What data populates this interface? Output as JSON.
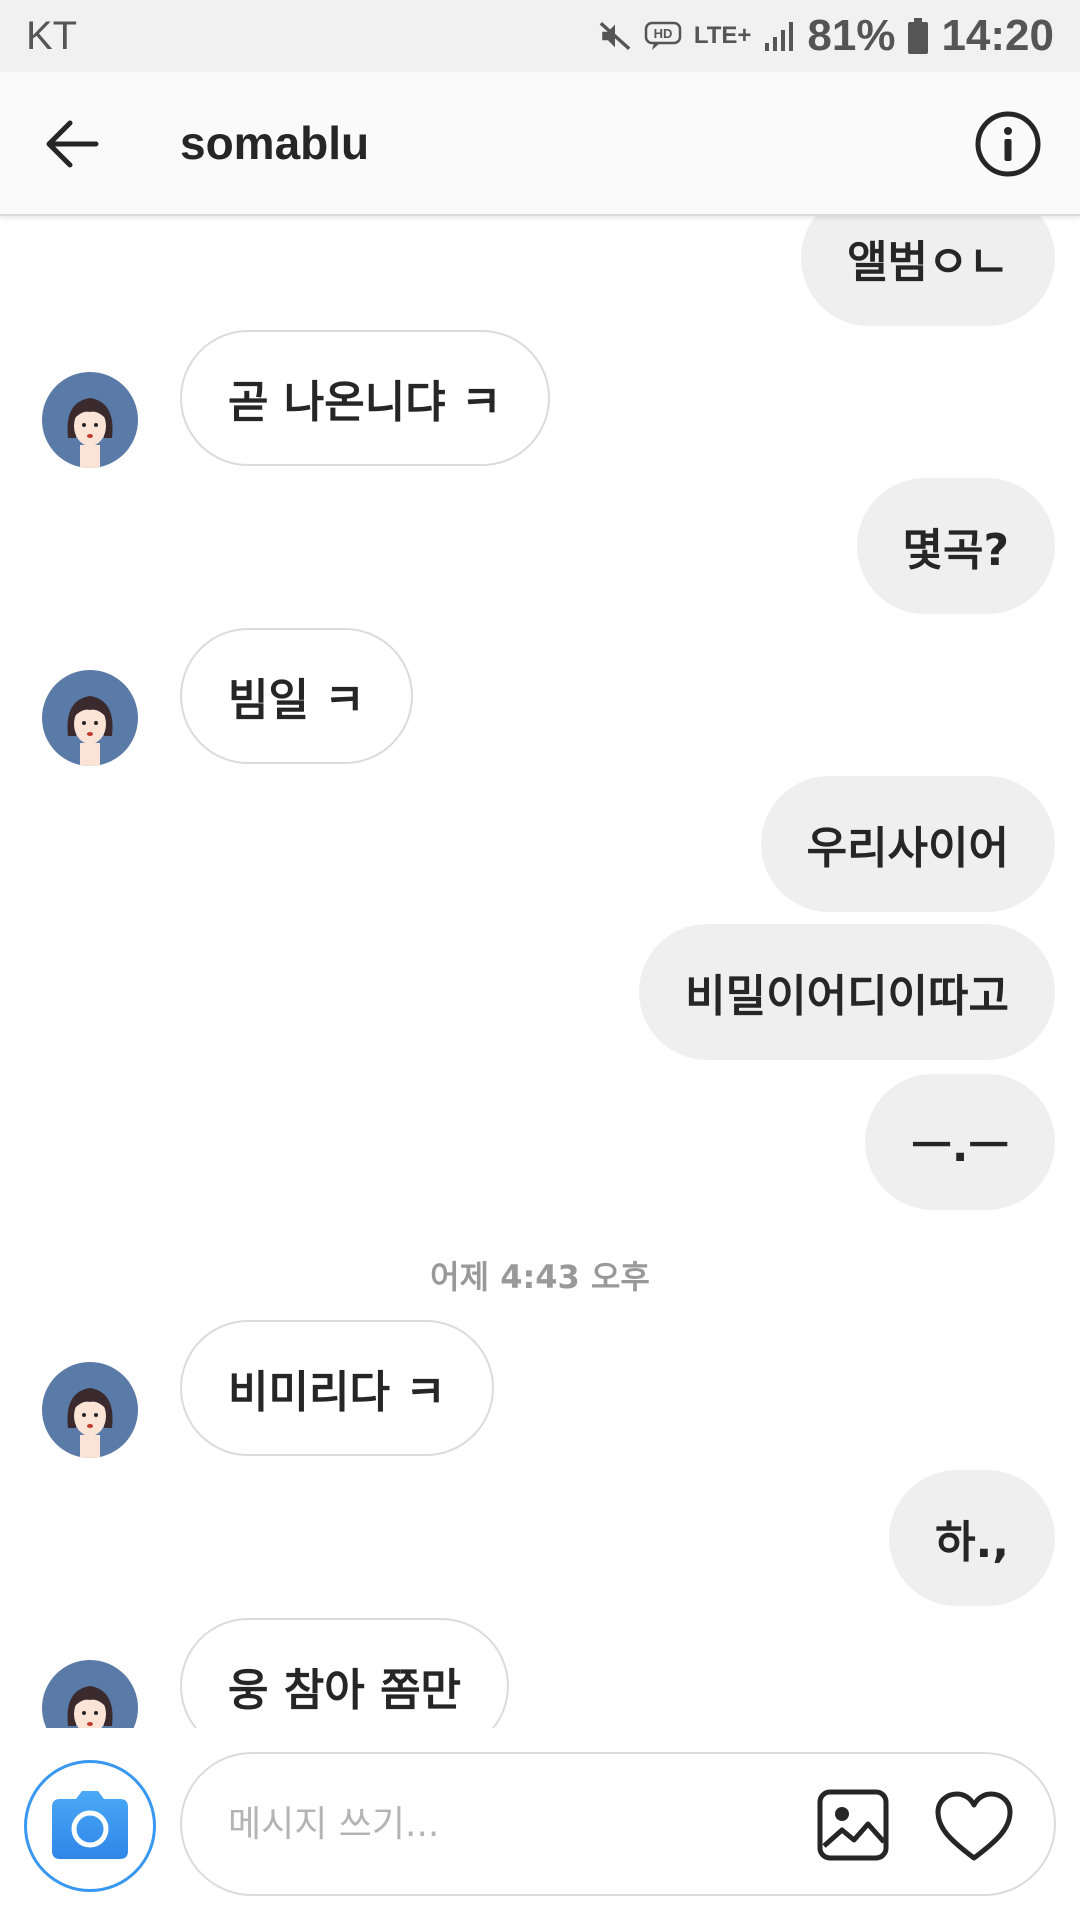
{
  "status_bar": {
    "carrier": "KT",
    "network": "LTE+",
    "battery": "81%",
    "time": "14:20",
    "icons": [
      "mute-icon",
      "hd-voice-icon",
      "lte-plus-icon",
      "signal-icon",
      "battery-icon"
    ]
  },
  "header": {
    "title": "somablu",
    "back_icon": "back-arrow-icon",
    "info_icon": "info-icon"
  },
  "messages": [
    {
      "side": "sent",
      "text": "앨범ㅇㄴ"
    },
    {
      "side": "received",
      "text": "곧 나온니댜 ㅋ"
    },
    {
      "side": "sent",
      "text": "몇곡?"
    },
    {
      "side": "received",
      "text": "빔일 ㅋ"
    },
    {
      "side": "sent",
      "text": "우리사이어"
    },
    {
      "side": "sent",
      "text": "비밀이어디이따고"
    },
    {
      "side": "sent",
      "text": "ㅡ.ㅡ"
    },
    {
      "side": "timestamp",
      "text": "어제 4:43 오후"
    },
    {
      "side": "received",
      "text": "비미리다 ㅋ"
    },
    {
      "side": "sent",
      "text": "하.,"
    },
    {
      "side": "received",
      "text": "웅 참아 쫌만"
    }
  ],
  "composer": {
    "placeholder": "메시지 쓰기...",
    "value": "",
    "camera_icon": "camera-icon",
    "gallery_icon": "image-gallery-icon",
    "like_icon": "heart-icon"
  },
  "colors": {
    "accent": "#3897f0",
    "sent_bubble": "#efefef",
    "received_border": "#dbdbdb",
    "avatar_bg": "#5a7aa8",
    "timestamp": "#999999"
  }
}
